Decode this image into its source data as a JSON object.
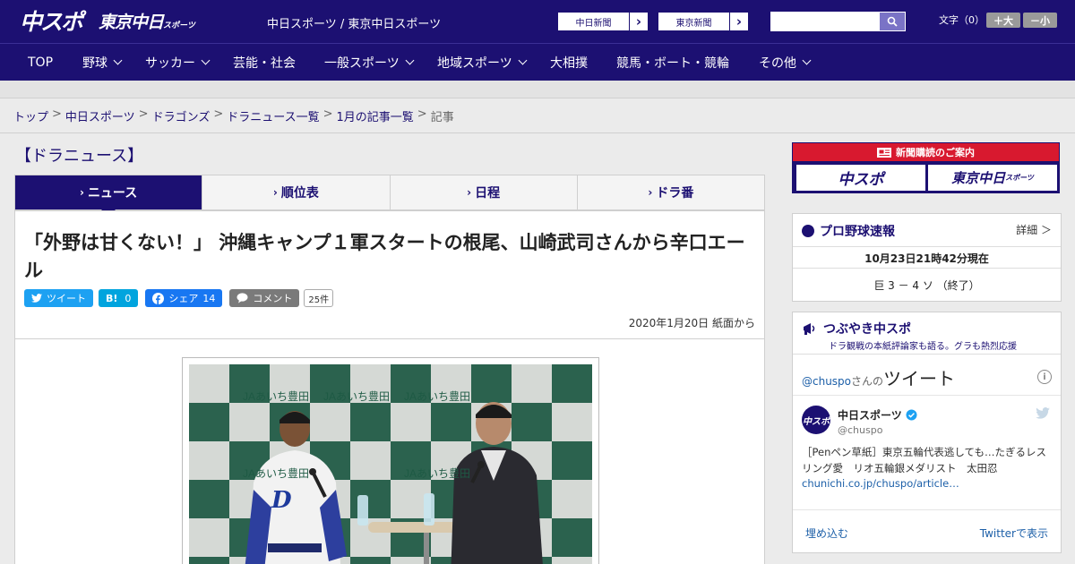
{
  "header": {
    "logo_main": "中スポ",
    "logo_tokyo": "東京中日",
    "logo_tokyo_sub": "スポーツ",
    "site_name": "中日スポーツ / 東京中日スポーツ",
    "paper_buttons": [
      "中日新聞",
      "東京新聞"
    ],
    "search_placeholder": "",
    "font_size_label": "文字（0）",
    "font_up": "＋大",
    "font_down": "－小"
  },
  "nav": {
    "items": [
      {
        "label": "TOP",
        "chevron": false
      },
      {
        "label": "野球",
        "chevron": true
      },
      {
        "label": "サッカー",
        "chevron": true
      },
      {
        "label": "芸能・社会",
        "chevron": false
      },
      {
        "label": "一般スポーツ",
        "chevron": true
      },
      {
        "label": "地域スポーツ",
        "chevron": true
      },
      {
        "label": "大相撲",
        "chevron": false
      },
      {
        "label": "競馬・ボート・競輪",
        "chevron": false
      },
      {
        "label": "その他",
        "chevron": true
      }
    ]
  },
  "breadcrumb": [
    "トップ",
    "中日スポーツ",
    "ドラゴンズ",
    "ドラニュース一覧",
    "1月の記事一覧",
    "記事"
  ],
  "section_title": "【ドラニュース】",
  "tabs": [
    "ニュース",
    "順位表",
    "日程",
    "ドラ番"
  ],
  "article": {
    "headline": "「外野は甘くない！」 沖縄キャンプ１軍スタートの根尾、山崎武司さんから辛口エール",
    "social": {
      "tweet": "ツイート",
      "hatena": "B!",
      "hatena_count": "0",
      "share": "シェア",
      "share_count": "14",
      "comment": "コメント",
      "comment_count": "25件"
    },
    "dateline": "2020年1月20日 紙面から",
    "photo_banner_text": "JAあいち豊田"
  },
  "sidebar": {
    "ad_title": "新聞購読のご案内",
    "ad_left": "中スポ",
    "ad_right": "東京中日",
    "ad_right_sub": "スポーツ",
    "baseball": {
      "title": "プロ野球速報",
      "detail": "詳細 ＞",
      "timestamp": "10月23日21時42分現在",
      "score": "巨 3 － 4 ソ （終了）"
    },
    "tweets": {
      "title": "つぶやき中スポ",
      "subtitle": "ドラ観戦の本紙評論家も語る。グラも熱烈応援",
      "handle_prefix": "@chuspo",
      "handle_suffix": "さんの",
      "heading": "ツイート",
      "account_name": "中日スポーツ",
      "account_handle": "@chuspo",
      "tweet_text": "［Penペン草紙］東京五輪代表逃しても…たぎるレスリング愛　リオ五輪銀メダリスト　太田忍",
      "tweet_link": "chunichi.co.jp/chuspo/article…",
      "embed": "埋め込む",
      "view": "Twitterで表示"
    }
  },
  "colors": {
    "brand": "#1c1072",
    "twitter": "#1da1f2",
    "hatena": "#00a4de",
    "facebook": "#1877f2",
    "comment": "#7a7a7a",
    "ad_red": "#d8192f"
  }
}
